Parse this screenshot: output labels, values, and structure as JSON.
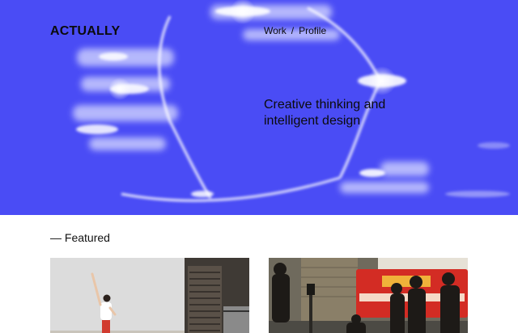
{
  "header": {
    "logo": "ACTUALLY",
    "nav": [
      {
        "label": "Work"
      },
      {
        "label": "Profile"
      }
    ],
    "nav_separator": "/"
  },
  "hero": {
    "tagline": "Creative thinking and intelligent design",
    "background_color": "#4a4cf5"
  },
  "featured": {
    "title": "— Featured",
    "cards": [
      {
        "image": "dancer-in-studio-photo"
      },
      {
        "image": "city-street-with-red-bus-photo"
      }
    ]
  }
}
